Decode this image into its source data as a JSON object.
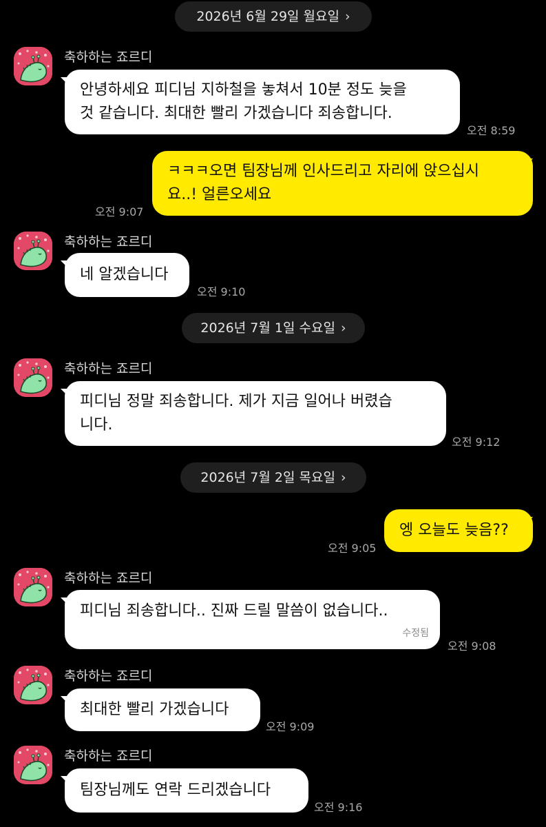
{
  "sender_name": "축하하는 죠르디",
  "dates": [
    {
      "label": "2026년 6월 29일 월요일"
    },
    {
      "label": "2026년 7월 1일 수요일"
    },
    {
      "label": "2026년 7월 2일 목요일"
    }
  ],
  "date_chevron": "›",
  "messages": [
    {
      "side": "in",
      "text": "안녕하세요 피디님 지하철을 놓쳐서 10분 정도 늦을\n것 같습니다. 최대한 빨리 가겠습니다 죄송합니다.",
      "time": "오전 8:59"
    },
    {
      "side": "out",
      "text": "ㅋㅋㅋ오면 팀장님께 인사드리고 자리에 앉으십시\n요..! 얼른오세요",
      "time": "오전 9:07"
    },
    {
      "side": "in",
      "text": "네 알겠습니다",
      "time": "오전 9:10"
    },
    {
      "side": "in",
      "text": "피디님 정말 죄송합니다. 제가 지금 일어나 버렸습\n니다.",
      "time": "오전 9:12"
    },
    {
      "side": "out",
      "text": "엥 오늘도 늦음??",
      "time": "오전 9:05"
    },
    {
      "side": "in",
      "text": "피디님 죄송합니다.. 진짜 드릴 말씀이 없습니다..",
      "time": "오전 9:08",
      "edited": "수정됨"
    },
    {
      "side": "in",
      "text": "최대한 빨리 가겠습니다",
      "time": "오전 9:09"
    },
    {
      "side": "in",
      "text": "팀장님께도 연락 드리겠습니다",
      "time": "오전 9:16"
    }
  ],
  "colors": {
    "background": "#000000",
    "incoming_bubble": "#ffffff",
    "outgoing_bubble": "#ffea00",
    "avatar_bg": "#e44867",
    "date_pill": "#1f1f1f"
  },
  "icons": {
    "avatar": "jordy-dinosaur-avatar-icon",
    "chevron": "chevron-right-icon"
  }
}
